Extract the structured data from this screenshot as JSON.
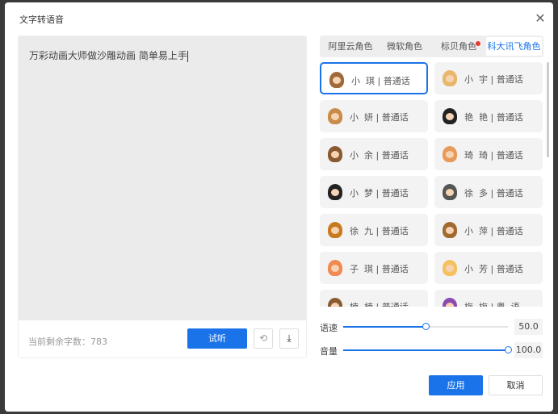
{
  "dialog": {
    "title": "文字转语音",
    "close_icon": "close-icon"
  },
  "editor": {
    "text": "万彩动画大师做沙雕动画 简单易上手",
    "remaining_label": "当前剩余字数：783",
    "try_label": "试听",
    "history_icon": "history-icon",
    "download_icon": "download-icon"
  },
  "tabs": [
    {
      "label": "阿里云角色"
    },
    {
      "label": "微软角色"
    },
    {
      "label": "标贝角色",
      "badge": true
    },
    {
      "label": "科大讯飞角色",
      "active": true
    }
  ],
  "voices": [
    {
      "label": "小  琪 | 普通话",
      "color": "#a0693a",
      "selected": true
    },
    {
      "label": "小  宇 | 普通话",
      "color": "#e8b76a"
    },
    {
      "label": "小  妍 | 普通话",
      "color": "#c98b4a"
    },
    {
      "label": "艳  艳 | 普通话",
      "color": "#222222"
    },
    {
      "label": "小  余 | 普通话",
      "color": "#8a5a30"
    },
    {
      "label": "琦  琦 | 普通话",
      "color": "#e89a5a"
    },
    {
      "label": "小  梦 | 普通话",
      "color": "#222222"
    },
    {
      "label": "徐  多 | 普通话",
      "color": "#555555"
    },
    {
      "label": "徐  九 | 普通话",
      "color": "#c87a20"
    },
    {
      "label": "小  萍 | 普通话",
      "color": "#a06a30"
    },
    {
      "label": "子  琪 | 普通话",
      "color": "#f08a50"
    },
    {
      "label": "小  芳 | 普通话",
      "color": "#f5c060"
    },
    {
      "label": "楠  楠 | 普通话",
      "color": "#8a5a30"
    },
    {
      "label": "梅  梅 | 粤  语",
      "color": "#8a4ab0"
    }
  ],
  "sliders": [
    {
      "label": "语速",
      "value": "50.0",
      "fraction": 0.5
    },
    {
      "label": "音量",
      "value": "100.0",
      "fraction": 1.0
    }
  ],
  "actions": {
    "apply": "应用",
    "cancel": "取消"
  }
}
